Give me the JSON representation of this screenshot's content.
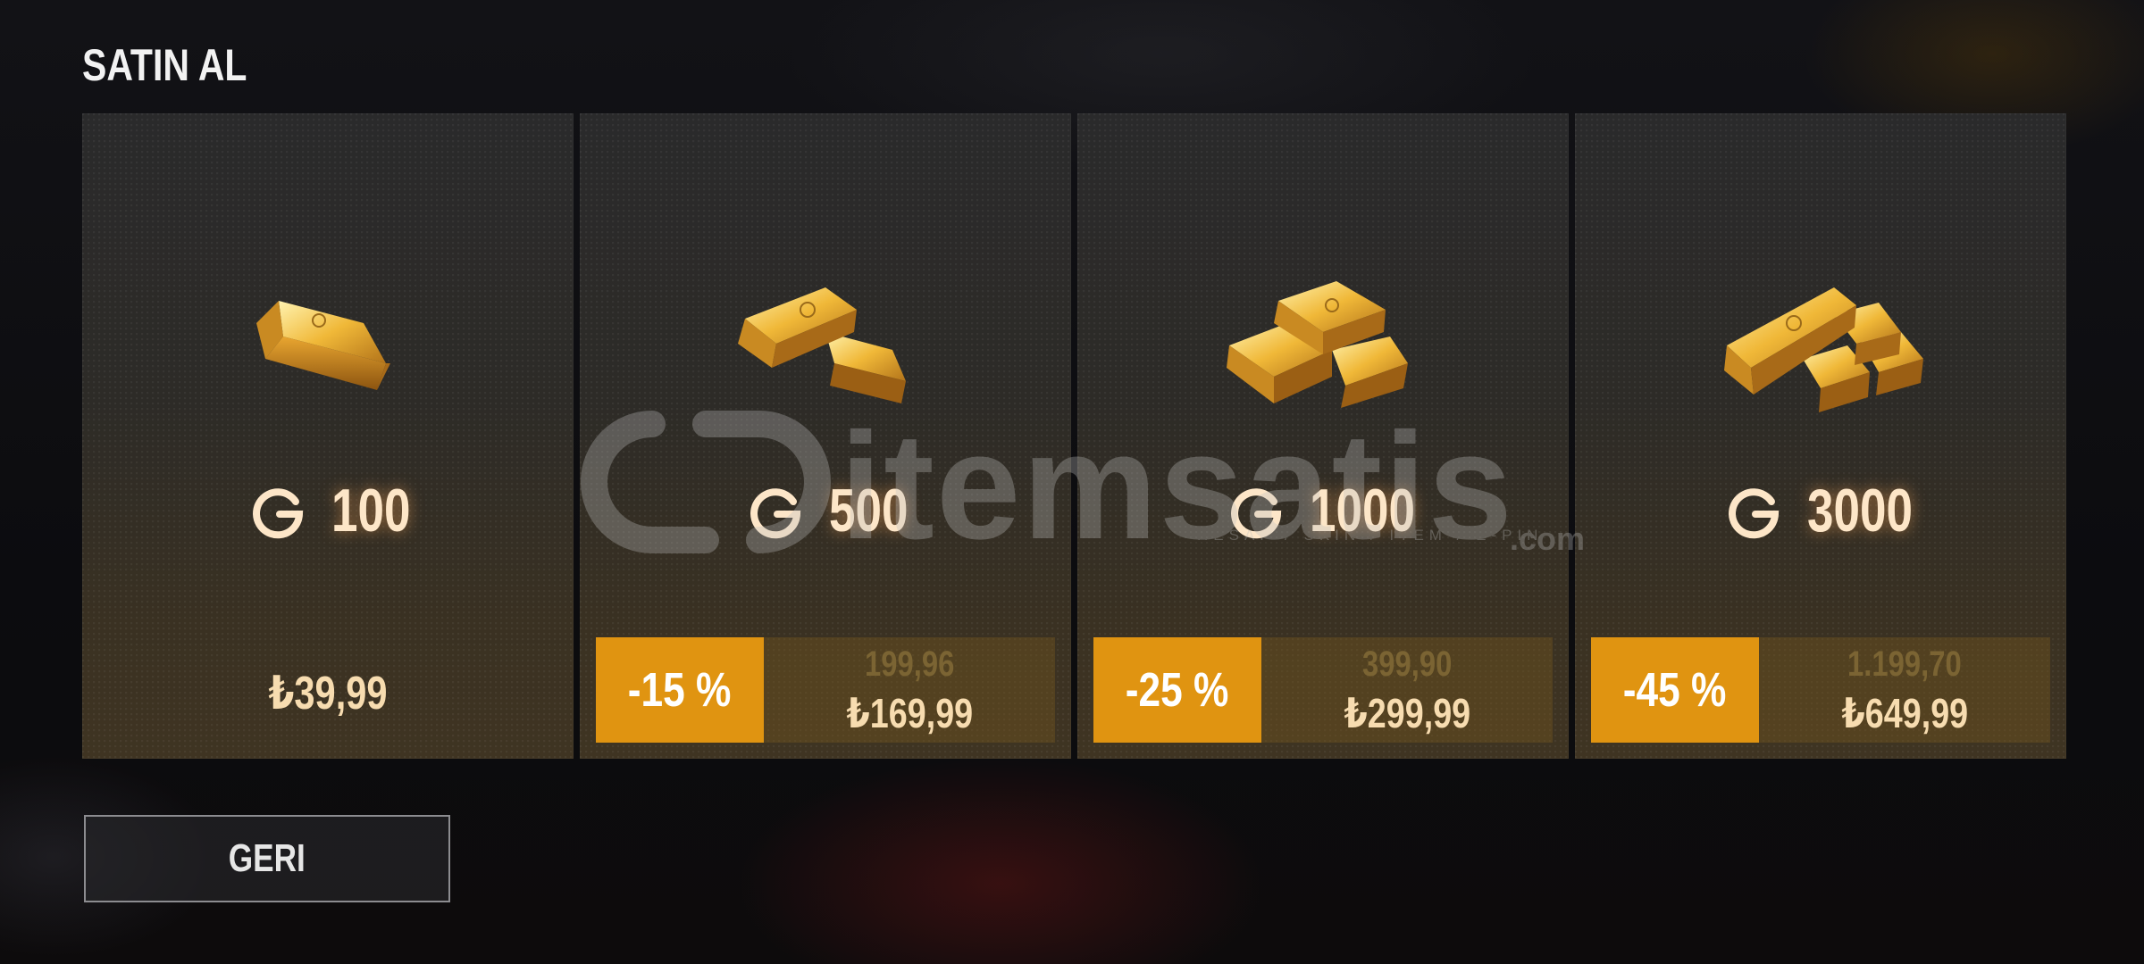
{
  "header": {
    "title": "SATIN AL"
  },
  "currency_icon": "gold-g-icon",
  "packages": [
    {
      "amount": "100",
      "price": "₺39,99"
    },
    {
      "amount": "500",
      "discount": "-15 %",
      "old_price": "199,96",
      "price": "₺169,99"
    },
    {
      "amount": "1000",
      "discount": "-25 %",
      "old_price": "399,90",
      "price": "₺299,99"
    },
    {
      "amount": "3000",
      "discount": "-45 %",
      "old_price": "1.199,70",
      "price": "₺649,99"
    }
  ],
  "watermark": {
    "brand": "itemsatis",
    "tagline": "HESAP / SKIN / ITEM / E-PIN",
    "suffix": ".com"
  },
  "footer": {
    "back_label": "GERI"
  },
  "colors": {
    "accent": "#e09411",
    "gold_text": "#fde6c8",
    "price_text": "#f7dcb0"
  }
}
